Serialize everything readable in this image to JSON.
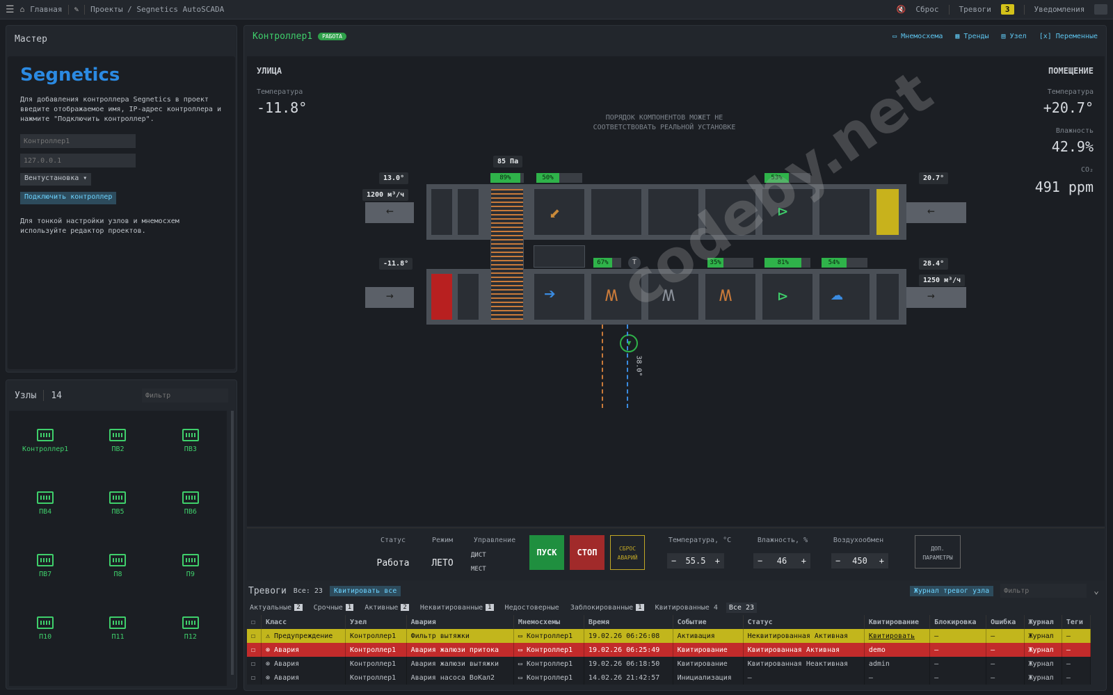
{
  "topbar": {
    "home": "Главная",
    "breadcrumb": "Проекты / Segnetics AutoSCADA",
    "reset": "Сброс",
    "alarms_label": "Тревоги",
    "alarms_count": "3",
    "notifications_label": "Уведомления"
  },
  "master": {
    "title": "Мастер",
    "logo": "Segnetics",
    "text1": "Для добавления контроллера Segnetics в проект введите отображаемое имя, IP-адрес контроллера и нажмите \"Подключить контроллер\".",
    "name_placeholder": "Контроллер1",
    "ip_placeholder": "127.0.0.1",
    "type_select": "Вентустановка ▾",
    "connect_button": "Подключить контроллер",
    "text2": "Для тонкой настройки узлов и мнемосхем используйте редактор проектов."
  },
  "nodes": {
    "title": "Узлы",
    "count": "14",
    "filter_placeholder": "Фильтр",
    "items": [
      "Контроллер1",
      "ПВ2",
      "ПВ3",
      "ПВ4",
      "ПВ5",
      "ПВ6",
      "ПВ7",
      "П8",
      "П9",
      "П10",
      "П11",
      "П12"
    ]
  },
  "controller": {
    "name": "Контроллер1",
    "status": "РАБОТА",
    "tabs": [
      "Мнемосхема",
      "Тренды",
      "Узел",
      "Переменные"
    ]
  },
  "scheme": {
    "street_label": "УЛИЦА",
    "street_temp_label": "Температура",
    "street_temp": "-11.8°",
    "room_label": "ПОМЕЩЕНИЕ",
    "room_temp_label": "Температура",
    "room_temp": "+20.7°",
    "humidity_label": "Влажность",
    "humidity": "42.9%",
    "co2_label": "CO₂",
    "co2": "491 ppm",
    "note": "ПОРЯДОК КОМПОНЕНТОВ МОЖЕТ НЕ СООТВЕТСТВОВАТЬ РЕАЛЬНОЙ УСТАНОВКЕ",
    "tags": {
      "exhaust_out_temp": "13.0°",
      "exhaust_flow": "1200 м³/ч",
      "pressure": "85 Па",
      "supply_in_temp": "-11.8°",
      "return_temp": "20.7°",
      "supply_temp": "28.4°",
      "supply_flow": "1250 м³/ч",
      "water_temp": "38.0°"
    },
    "bars": {
      "recup": 89,
      "bypass": 50,
      "exhaust_fan": 53,
      "heater": 67,
      "cooler": 35,
      "supply_fan": 81,
      "humidifier": 54
    }
  },
  "control": {
    "status_label": "Статус",
    "status_value": "Работа",
    "mode_label": "Режим",
    "mode_value": "ЛЕТО",
    "control_label": "Управление",
    "remote": "ДИСТ",
    "local": "МЕСТ",
    "start": "ПУСК",
    "stop": "СТОП",
    "reset_alarms": "СБРОС АВАРИЙ",
    "temp_label": "Температура, °С",
    "temp_value": "55.5",
    "hum_label": "Влажность, %",
    "hum_value": "46",
    "air_label": "Воздухообмен",
    "air_value": "450",
    "extra": "ДОП. ПАРАМЕТРЫ"
  },
  "alarms": {
    "title": "Тревоги",
    "all_count": "Все: 23",
    "ack_all": "Квитировать все",
    "journal": "Журнал тревог узла",
    "filter_placeholder": "Фильтр",
    "tabs": [
      {
        "label": "Актуальные",
        "n": "2"
      },
      {
        "label": "Срочные",
        "n": "1"
      },
      {
        "label": "Активные",
        "n": "2"
      },
      {
        "label": "Неквитированные",
        "n": "1"
      },
      {
        "label": "Недостоверные",
        "n": ""
      },
      {
        "label": "Заблокированные",
        "n": "1"
      },
      {
        "label": "Квитированные 4",
        "n": ""
      },
      {
        "label": "Все 23",
        "n": ""
      }
    ],
    "columns": [
      "Класс",
      "Узел",
      "Авария",
      "Мнемосхемы",
      "Время",
      "Событие",
      "Статус",
      "Квитирование",
      "Блокировка",
      "Ошибка",
      "Журнал",
      "Теги"
    ],
    "rows": [
      {
        "cls": "Предупреждение",
        "node": "Контроллер1",
        "alarm": "Фильтр вытяжки",
        "mn": "Контроллер1",
        "time": "19.02.26 06:26:08",
        "event": "Активация",
        "status": "Неквитированная Активная",
        "ack": "Квитировать",
        "block": "—",
        "err": "—",
        "log": "Журнал",
        "tags": "—",
        "kind": "warn"
      },
      {
        "cls": "Авария",
        "node": "Контроллер1",
        "alarm": "Авария жалюзи притока",
        "mn": "Контроллер1",
        "time": "19.02.26 06:25:49",
        "event": "Квитирование",
        "status": "Квитированная Активная",
        "ack": "demo",
        "block": "—",
        "err": "—",
        "log": "Журнал",
        "tags": "—",
        "kind": "crit"
      },
      {
        "cls": "Авария",
        "node": "Контроллер1",
        "alarm": "Авария жалюзи вытяжки",
        "mn": "Контроллер1",
        "time": "19.02.26 06:18:50",
        "event": "Квитирование",
        "status": "Квитированная Неактивная",
        "ack": "admin",
        "block": "—",
        "err": "—",
        "log": "Журнал",
        "tags": "—",
        "kind": "norm"
      },
      {
        "cls": "Авария",
        "node": "Контроллер1",
        "alarm": "Авария насоса ВоКал2",
        "mn": "Контроллер1",
        "time": "14.02.26 21:42:57",
        "event": "Инициализация",
        "status": "—",
        "ack": "—",
        "block": "—",
        "err": "—",
        "log": "Журнал",
        "tags": "—",
        "kind": "norm"
      }
    ]
  },
  "watermark": "codeby.net"
}
